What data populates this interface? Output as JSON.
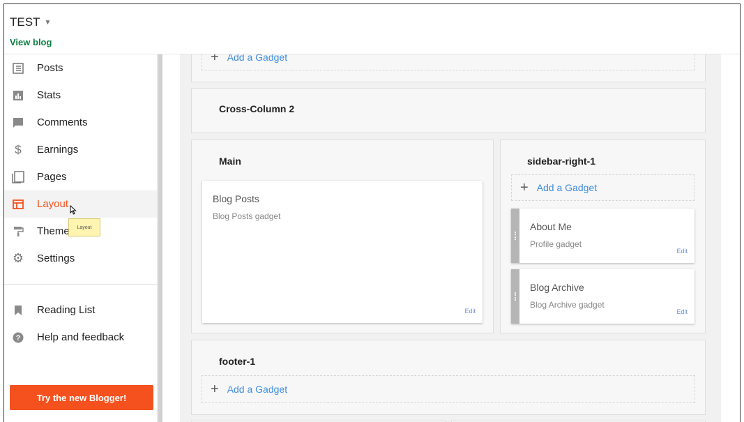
{
  "header": {
    "blog_title": "TEST",
    "view_blog": "View blog"
  },
  "sidebar": {
    "items": [
      {
        "label": "Posts",
        "icon": "posts-icon"
      },
      {
        "label": "Stats",
        "icon": "stats-icon"
      },
      {
        "label": "Comments",
        "icon": "comments-icon"
      },
      {
        "label": "Earnings",
        "icon": "dollar-icon"
      },
      {
        "label": "Pages",
        "icon": "pages-icon"
      },
      {
        "label": "Layout",
        "icon": "layout-icon",
        "active": true
      },
      {
        "label": "Theme",
        "icon": "theme-roller-icon"
      },
      {
        "label": "Settings",
        "icon": "gear-icon"
      }
    ],
    "secondary_items": [
      {
        "label": "Reading List",
        "icon": "bookmark-icon"
      },
      {
        "label": "Help and feedback",
        "icon": "help-icon"
      }
    ],
    "tooltip": "Layout",
    "try_button": "Try the new Blogger!",
    "accent_color": "#f4511e"
  },
  "layout": {
    "top_add_gadget": "Add a Gadget",
    "cross_column_2": {
      "title": "Cross-Column 2"
    },
    "main": {
      "title": "Main",
      "gadgets": [
        {
          "title": "Blog Posts",
          "subtitle": "Blog Posts gadget",
          "edit": "Edit"
        }
      ]
    },
    "sidebar_right_1": {
      "title": "sidebar-right-1",
      "add_gadget": "Add a Gadget",
      "gadgets": [
        {
          "title": "About Me",
          "subtitle": "Profile gadget",
          "edit": "Edit"
        },
        {
          "title": "Blog Archive",
          "subtitle": "Blog Archive gadget",
          "edit": "Edit"
        }
      ]
    },
    "footer_1": {
      "title": "footer-1",
      "add_gadget": "Add a Gadget"
    },
    "link_color": "#3d8de0"
  }
}
